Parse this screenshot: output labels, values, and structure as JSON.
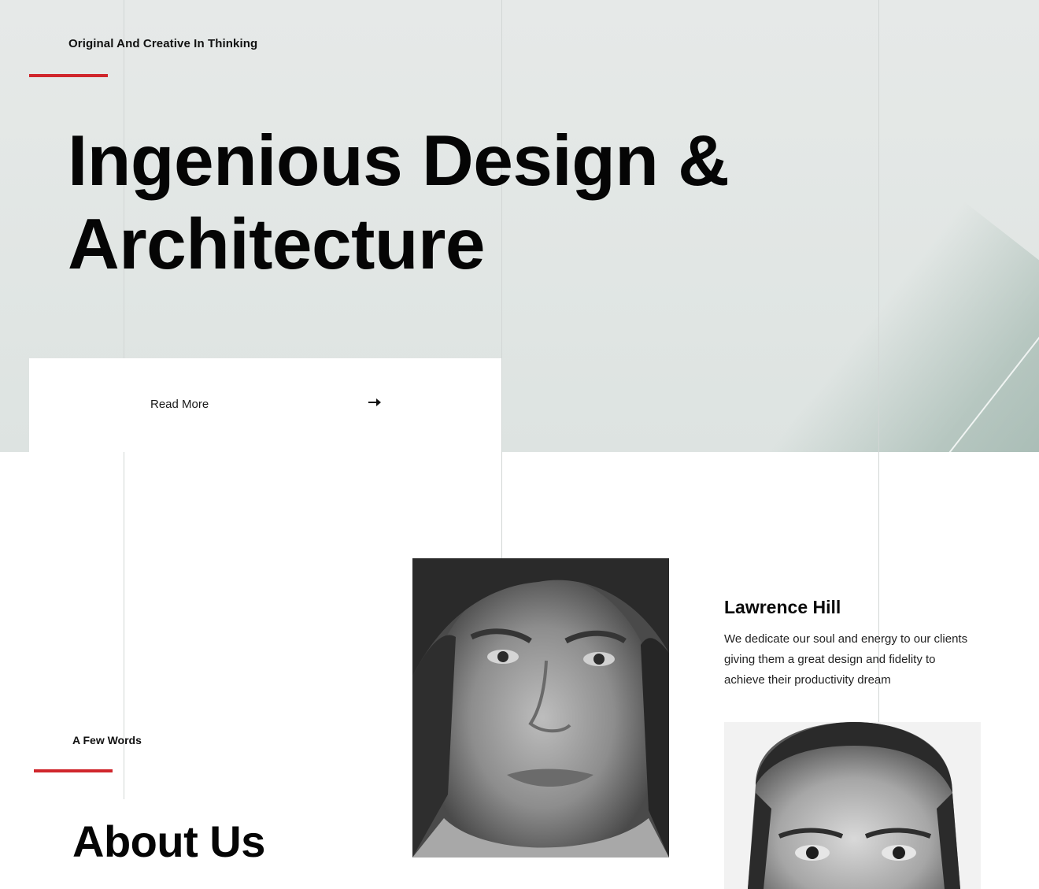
{
  "hero": {
    "tagline": "Original And Creative In Thinking",
    "title_line1": "Ingenious Design &",
    "title_line2": "Architecture",
    "read_more_label": "Read More",
    "read_more_icon": "arrow-right-icon"
  },
  "about": {
    "tag": "A Few Words",
    "title": "About Us"
  },
  "team": {
    "member_name": "Lawrence Hill",
    "member_bio": "We dedicate our soul and energy to our clients giving them a great design and fidelity to achieve their productivity dream"
  },
  "colors": {
    "accent": "#d0262c",
    "hero_background": "#e3e7e5",
    "text": "#0a0a0a"
  }
}
